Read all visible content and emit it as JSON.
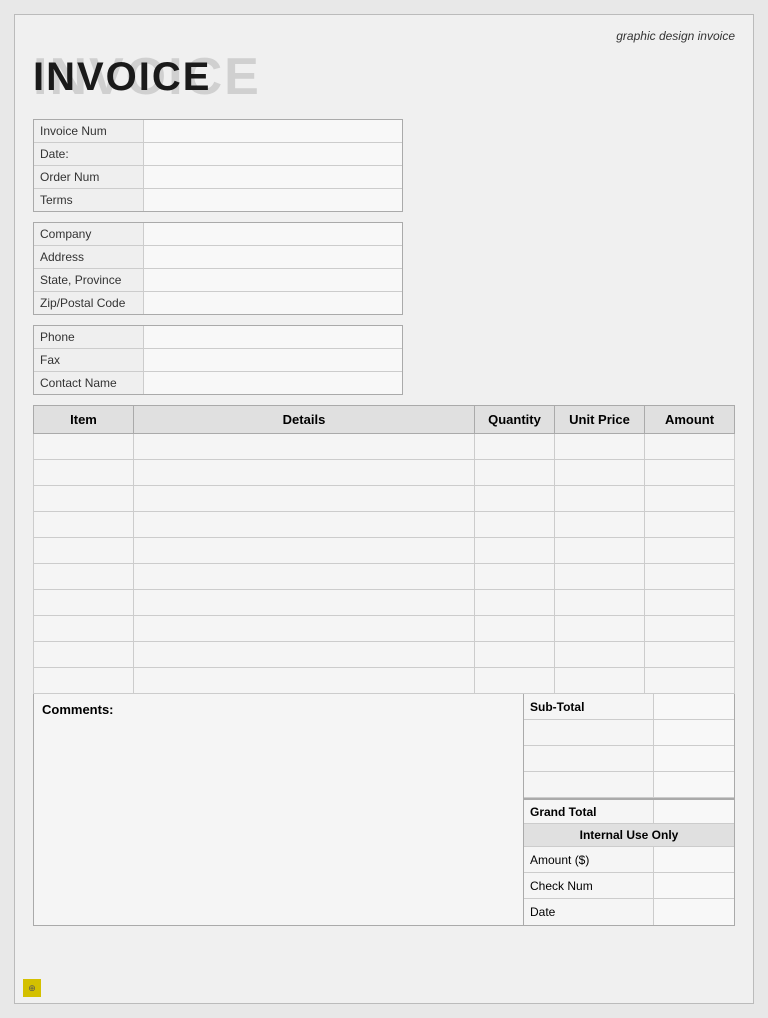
{
  "header": {
    "subtitle": "graphic design invoice",
    "title_shadow": "INVOICE",
    "title_main": "INVOICE"
  },
  "invoice_info": {
    "fields": [
      {
        "label": "Invoice Num",
        "value": ""
      },
      {
        "label": "Date:",
        "value": ""
      },
      {
        "label": "Order Num",
        "value": ""
      },
      {
        "label": "Terms",
        "value": ""
      }
    ]
  },
  "billing_info": {
    "fields": [
      {
        "label": "Company",
        "value": ""
      },
      {
        "label": "Address",
        "value": ""
      },
      {
        "label": "State, Province",
        "value": ""
      },
      {
        "label": "Zip/Postal Code",
        "value": ""
      }
    ]
  },
  "contact_info": {
    "fields": [
      {
        "label": "Phone",
        "value": ""
      },
      {
        "label": "Fax",
        "value": ""
      },
      {
        "label": "Contact Name",
        "value": ""
      }
    ]
  },
  "items_table": {
    "headers": [
      "Item",
      "Details",
      "Quantity",
      "Unit Price",
      "Amount"
    ],
    "rows": [
      [
        "",
        "",
        "",
        "",
        ""
      ],
      [
        "",
        "",
        "",
        "",
        ""
      ],
      [
        "",
        "",
        "",
        "",
        ""
      ],
      [
        "",
        "",
        "",
        "",
        ""
      ],
      [
        "",
        "",
        "",
        "",
        ""
      ],
      [
        "",
        "",
        "",
        "",
        ""
      ],
      [
        "",
        "",
        "",
        "",
        ""
      ],
      [
        "",
        "",
        "",
        "",
        ""
      ],
      [
        "",
        "",
        "",
        "",
        ""
      ],
      [
        "",
        "",
        "",
        "",
        ""
      ]
    ]
  },
  "comments": {
    "label": "Comments:"
  },
  "totals": {
    "subtotal_label": "Sub-Total",
    "extra_rows": [
      "",
      "",
      ""
    ],
    "grand_total_label": "Grand Total",
    "internal_use_label": "Internal Use Only",
    "internal_fields": [
      {
        "label": "Amount ($)",
        "value": ""
      },
      {
        "label": "Check Num",
        "value": ""
      },
      {
        "label": "Date",
        "value": ""
      }
    ]
  }
}
